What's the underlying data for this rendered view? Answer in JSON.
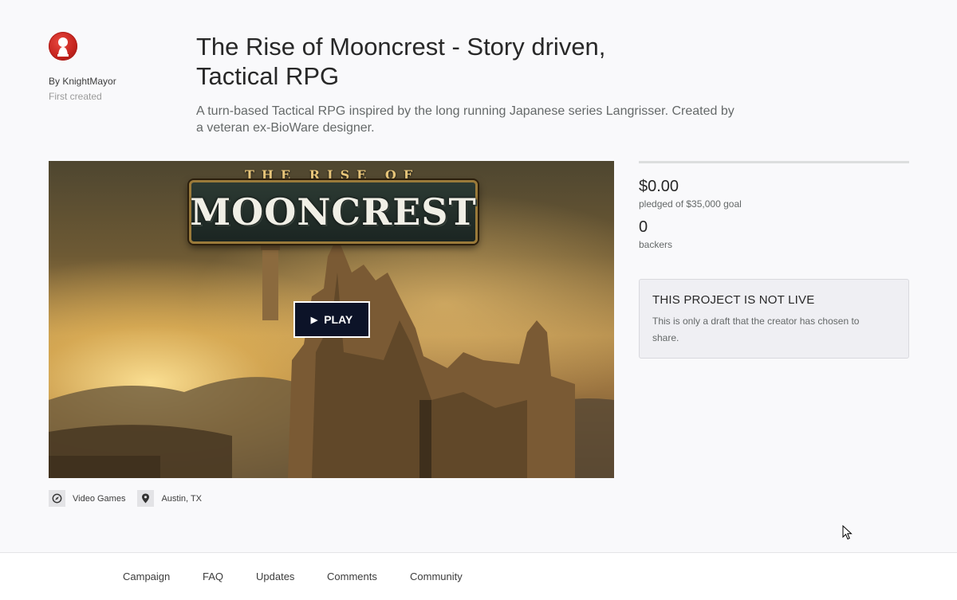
{
  "creator": {
    "by_label": "By KnightMayor",
    "first_created": "First created"
  },
  "project": {
    "title": "The Rise of Mooncrest - Story driven, Tactical RPG",
    "blurb": "A turn-based Tactical RPG inspired by the long running Japanese series Langrisser. Created by a veteran ex-BioWare designer."
  },
  "video": {
    "logo_top": "THE RISE OF",
    "logo_main": "MOONCREST",
    "play_label": "PLAY",
    "play_icon": "play-triangle-icon"
  },
  "tags": [
    {
      "label": "Video Games",
      "icon": "compass-icon"
    },
    {
      "label": "Austin, TX",
      "icon": "location-pin-icon"
    }
  ],
  "stats": {
    "pledged": "$0.00",
    "pledged_label": "pledged of $35,000 goal",
    "backers": "0",
    "backers_label": "backers"
  },
  "notice": {
    "heading": "THIS PROJECT IS NOT LIVE",
    "text": "This is only a draft that the creator has chosen to share."
  },
  "tabs": [
    "Campaign",
    "FAQ",
    "Updates",
    "Comments",
    "Community"
  ],
  "colors": {
    "avatar_red": "#c4231d",
    "play_button_bg": "#0c1328",
    "page_bg": "#f9f9fb"
  }
}
